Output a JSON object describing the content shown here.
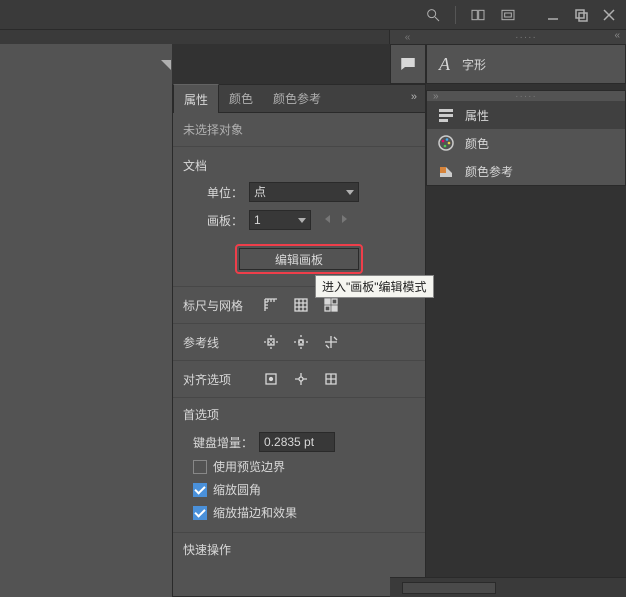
{
  "topbar": {
    "search_icon": "search",
    "layout1_icon": "layout-columns",
    "layout2_icon": "layout-frame",
    "minimize": "—",
    "maximize": "❐",
    "close": "✕"
  },
  "right_top": {
    "glyph_letter": "A",
    "glyph_label": "字形"
  },
  "right_list": {
    "items": [
      {
        "icon": "properties",
        "label": "属性",
        "selected": true
      },
      {
        "icon": "palette",
        "label": "颜色",
        "selected": false
      },
      {
        "icon": "swatch",
        "label": "颜色参考",
        "selected": false
      }
    ]
  },
  "panel": {
    "tabs": [
      {
        "label": "属性",
        "active": true
      },
      {
        "label": "颜色",
        "active": false
      },
      {
        "label": "颜色参考",
        "active": false
      }
    ],
    "selection_info": "未选择对象",
    "doc_section_title": "文档",
    "unit_label": "单位：",
    "unit_value": "点",
    "artboard_label": "画板：",
    "artboard_value": "1",
    "edit_artboard_button": "编辑画板",
    "tooltip": "进入\"画板\"编辑模式",
    "ruler_grid_label": "标尺与网格",
    "guides_label": "参考线",
    "align_label": "对齐选项",
    "prefs_title": "首选项",
    "key_increment_label": "键盘增量：",
    "key_increment_value": "0.2835 pt",
    "checkboxes": [
      {
        "label": "使用预览边界",
        "checked": false
      },
      {
        "label": "缩放圆角",
        "checked": true
      },
      {
        "label": "缩放描边和效果",
        "checked": true
      }
    ],
    "quick_actions_label": "快速操作"
  }
}
